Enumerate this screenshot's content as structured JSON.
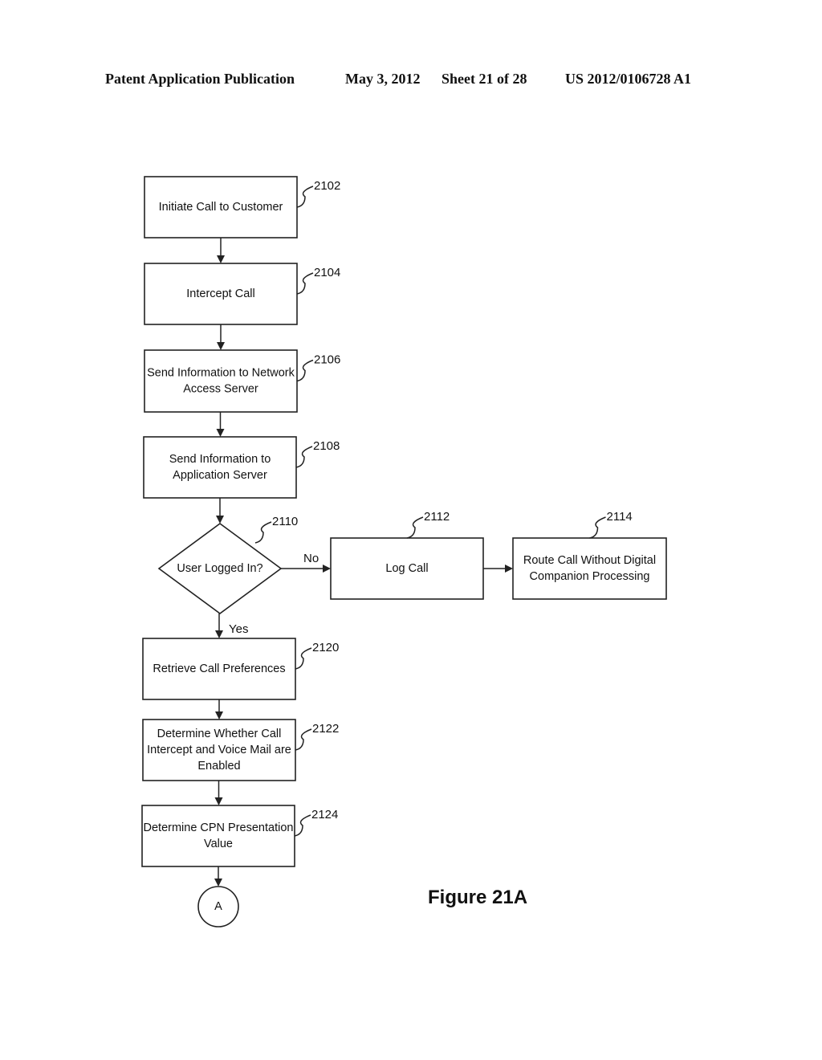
{
  "header": {
    "publication": "Patent Application Publication",
    "date": "May 3, 2012",
    "sheet": "Sheet 21 of 28",
    "number": "US 2012/0106728 A1"
  },
  "figure_label": "Figure 21A",
  "nodes": [
    {
      "id": "2102",
      "ref": "2102",
      "type": "process",
      "lines": [
        "Initiate Call to Customer"
      ]
    },
    {
      "id": "2104",
      "ref": "2104",
      "type": "process",
      "lines": [
        "Intercept Call"
      ]
    },
    {
      "id": "2106",
      "ref": "2106",
      "type": "process",
      "lines": [
        "Send Information to Network",
        "Access Server"
      ]
    },
    {
      "id": "2108",
      "ref": "2108",
      "type": "process",
      "lines": [
        "Send Information to",
        "Application Server"
      ]
    },
    {
      "id": "2110",
      "ref": "2110",
      "type": "decision",
      "lines": [
        "User Logged In?"
      ]
    },
    {
      "id": "2112",
      "ref": "2112",
      "type": "process",
      "lines": [
        "Log Call"
      ]
    },
    {
      "id": "2114",
      "ref": "2114",
      "type": "process",
      "lines": [
        "Route Call Without Digital",
        "Companion Processing"
      ]
    },
    {
      "id": "2120",
      "ref": "2120",
      "type": "process",
      "lines": [
        "Retrieve Call Preferences"
      ]
    },
    {
      "id": "2122",
      "ref": "2122",
      "type": "process",
      "lines": [
        "Determine Whether Call",
        "Intercept and Voice Mail are",
        "Enabled"
      ]
    },
    {
      "id": "2124",
      "ref": "2124",
      "type": "process",
      "lines": [
        "Determine CPN Presentation",
        "Value"
      ]
    },
    {
      "id": "A",
      "ref": "",
      "type": "connector",
      "lines": [
        "A"
      ]
    }
  ],
  "edges": [
    {
      "from": "2102",
      "to": "2104",
      "label": ""
    },
    {
      "from": "2104",
      "to": "2106",
      "label": ""
    },
    {
      "from": "2106",
      "to": "2108",
      "label": ""
    },
    {
      "from": "2108",
      "to": "2110",
      "label": ""
    },
    {
      "from": "2110",
      "to": "2112",
      "label": "No"
    },
    {
      "from": "2112",
      "to": "2114",
      "label": ""
    },
    {
      "from": "2110",
      "to": "2120",
      "label": "Yes"
    },
    {
      "from": "2120",
      "to": "2122",
      "label": ""
    },
    {
      "from": "2122",
      "to": "2124",
      "label": ""
    },
    {
      "from": "2124",
      "to": "A",
      "label": ""
    }
  ]
}
